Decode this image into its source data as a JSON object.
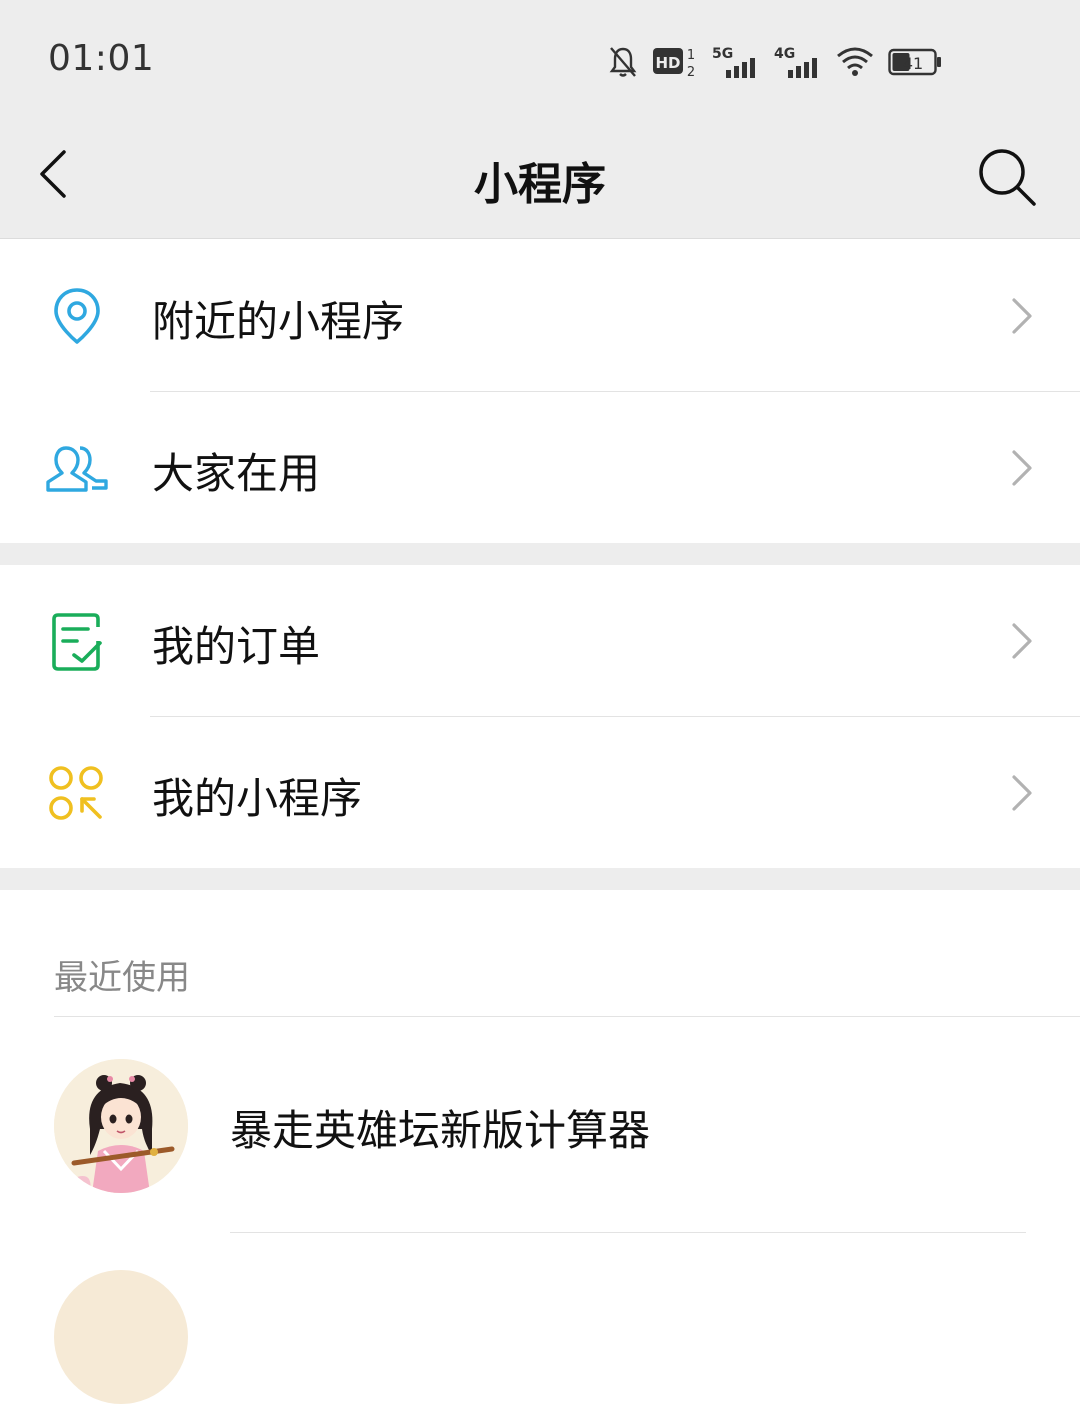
{
  "status_bar": {
    "time": "01:01",
    "network_5g": "5G",
    "network_4g": "4G",
    "hd_label": "HD",
    "battery": "41",
    "icons": [
      "bell-off-icon",
      "hd-call-icon",
      "signal-5g-icon",
      "signal-4g-icon",
      "wifi-icon",
      "battery-icon"
    ]
  },
  "header": {
    "title": "小程序",
    "back_icon": "chevron-left-icon",
    "search_icon": "search-icon"
  },
  "sections": [
    {
      "items": [
        {
          "label": "附近的小程序",
          "icon": "location-pin-icon",
          "color": "#2fa8e0"
        },
        {
          "label": "大家在用",
          "icon": "people-icon",
          "color": "#2fa8e0"
        }
      ]
    },
    {
      "items": [
        {
          "label": "我的订单",
          "icon": "order-check-icon",
          "color": "#1aad5a"
        },
        {
          "label": "我的小程序",
          "icon": "my-miniprogram-icon",
          "color": "#f0c020"
        }
      ]
    }
  ],
  "recent": {
    "heading": "最近使用",
    "items": [
      {
        "label": "暴走英雄坛新版计算器",
        "icon": "character-avatar"
      }
    ]
  },
  "colors": {
    "nav_background": "#ededed",
    "divider": "#e3e3e3",
    "chevron": "#b2b2b2",
    "secondary_text": "#888888"
  }
}
